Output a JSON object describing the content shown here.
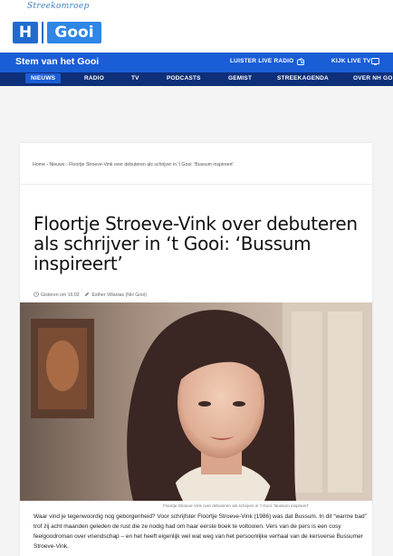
{
  "logo": {
    "script_text": "Streekomroep",
    "nh_text": "H",
    "region": "Gooi"
  },
  "radio_bar": {
    "title": "Stem van het Gooi",
    "live_radio": "LUISTER LIVE RADIO",
    "live_tv": "KIJK LIVE TV"
  },
  "nav": {
    "items": [
      "NIEUWS",
      "RADIO",
      "TV",
      "PODCASTS",
      "GEMIST",
      "STREEKAGENDA",
      "OVER NH GO"
    ]
  },
  "article": {
    "breadcrumb": [
      "Home",
      "Nieuws",
      "Floortje Stroeve-Vink over debuteren als schrijver in 't Gooi: 'Bussum inspireert'"
    ],
    "headline": "Floortje Stroeve-Vink over debuteren als schrijver in ‘t Gooi: ‘Bussum inspireert’",
    "time": "Gisteren om 16:02",
    "author": "Esther Villanias (NH Gooi)",
    "caption": "Floortje Stroeve-Vink over debuteren als schrijver in 't Gooi: 'Bussum inspireert'",
    "body": "Waar vind je tegenwoordig nog geborgenheid? Voor schrijfster Floortje Stroeve-Vink (1986) was dat Bussum. In dit “warme bad” trof zij acht maanden geleden de rust die ze nodig had om haar eerste boek te voltooien. Vers van de pers is een cosy feelgoodroman over vriendschap – en het heeft eigenlijk wel wat weg van het persoonlijke verhaal van de kersverse Bussumer Stroeve-Vink."
  },
  "colors": {
    "brand_blue": "#1a5ed6",
    "nav_navy": "#0e2f7a",
    "logo_blue": "#2f86e6"
  }
}
